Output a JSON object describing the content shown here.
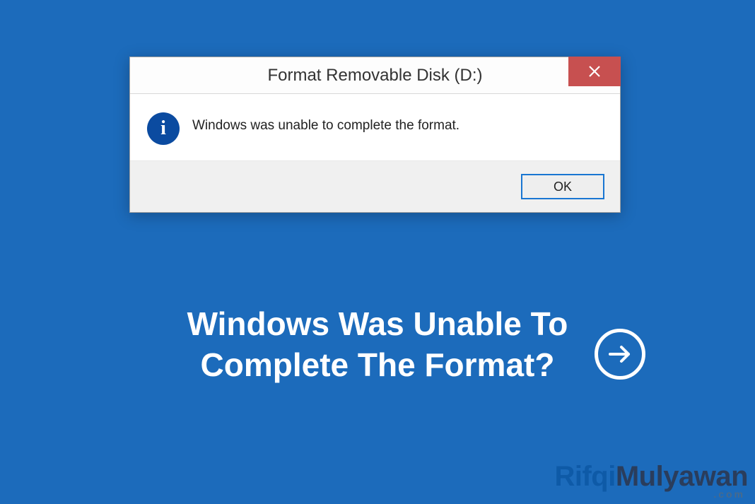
{
  "dialog": {
    "title": "Format Removable Disk (D:)",
    "message": "Windows was unable to complete the format.",
    "ok_label": "OK",
    "close_symbol": "×",
    "info_symbol": "i"
  },
  "headline": "Windows Was Unable To Complete The Format?",
  "watermark": {
    "part1": "Rifqi",
    "part2": "Mulyawan",
    "domain": ".com"
  }
}
